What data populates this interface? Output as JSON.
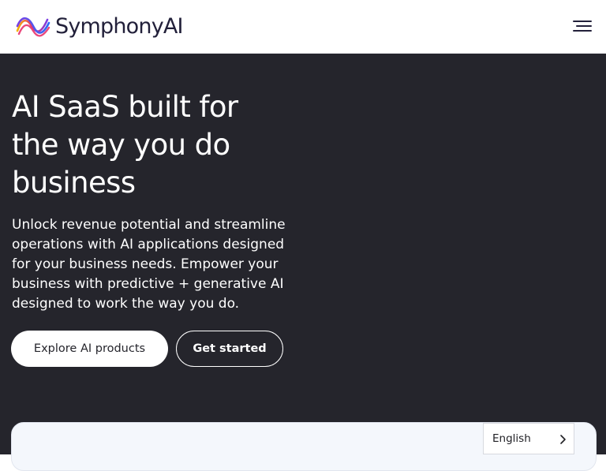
{
  "header": {
    "brand": "SymphonyAI",
    "logo_icon": "symphonyai-wave-logo-icon",
    "menu_icon": "hamburger-menu-icon"
  },
  "hero": {
    "title": "AI SaaS built for the way you do business",
    "description": "Unlock revenue potential and streamline operations with AI applications designed for your business needs. Empower your business with predictive + generative AI designed to work the way you do.",
    "primary_button": "Explore AI products",
    "secondary_button": "Get started"
  },
  "language_selector": {
    "selected": "English",
    "icon": "chevron-right-icon"
  },
  "colors": {
    "hero_background": "#25252c",
    "header_background": "#ffffff",
    "brand_text": "#22203a",
    "logo_gradient": [
      "#f5b400",
      "#e8336e",
      "#7b3fe4",
      "#2d6cf6"
    ]
  }
}
